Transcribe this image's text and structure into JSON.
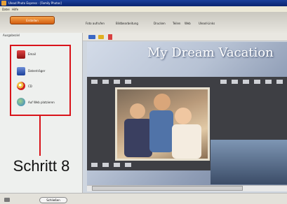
{
  "window": {
    "title": "Ulead Photo Express - [Family Photos]"
  },
  "menu": [
    "Datei",
    "Hilfe"
  ],
  "toolbar": {
    "primary_label": "Erstellen",
    "tabs": [
      "Foto aufrufen",
      "Bildbearbeitung",
      "Drucken",
      "Teilen",
      "Web",
      "Ulead-Links"
    ]
  },
  "panel": {
    "heading": "Ausgabeziel",
    "actions": [
      {
        "label": "Email"
      },
      {
        "label": "Datenträger"
      },
      {
        "label": "CD"
      },
      {
        "label": "Auf Web platzieren"
      }
    ]
  },
  "bottom": {
    "button_label": "Schließen"
  },
  "canvas": {
    "title": "My Dream Vacation"
  },
  "annotation": {
    "step_label": "Schritt 8",
    "color": "#d9131a"
  },
  "colors": {
    "accent": "#d35f12",
    "titlebar": "#0a2470"
  }
}
